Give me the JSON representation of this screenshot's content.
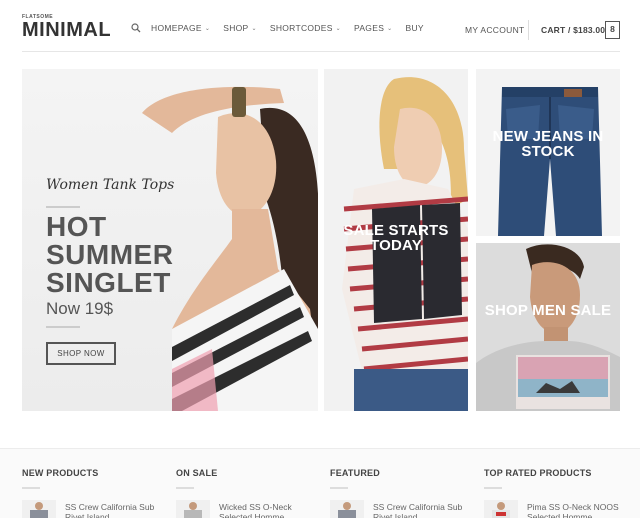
{
  "header": {
    "logo_small": "FLATSOME",
    "logo_main": "MINIMAL",
    "nav": [
      {
        "label": "HOMEPAGE",
        "has_dropdown": true
      },
      {
        "label": "SHOP",
        "has_dropdown": true
      },
      {
        "label": "SHORTCODES",
        "has_dropdown": true
      },
      {
        "label": "PAGES",
        "has_dropdown": true
      },
      {
        "label": "BUY",
        "has_dropdown": false
      }
    ],
    "account": "MY ACCOUNT",
    "cart": "CART / $183.00",
    "cart_count": "8"
  },
  "banners": {
    "main": {
      "script": "Women Tank Tops",
      "headline": "HOT SUMMER SINGLET",
      "price": "Now 19$",
      "button": "SHOP NOW"
    },
    "sale": {
      "text": "SALE STARTS TODAY"
    },
    "jeans": {
      "text": "NEW JEANS IN STOCK"
    },
    "men": {
      "text": "SHOP MEN SALE"
    }
  },
  "footer": {
    "columns": [
      {
        "title": "NEW PRODUCTS",
        "item": "SS Crew California Sub Rivet Island"
      },
      {
        "title": "ON SALE",
        "item": "Wicked SS O-Neck Selected Homme"
      },
      {
        "title": "FEATURED",
        "item": "SS Crew California Sub Rivet Island"
      },
      {
        "title": "TOP RATED PRODUCTS",
        "item": "Pima SS O-Neck NOOS Selected Homme"
      }
    ]
  },
  "colors": {
    "accent_dark": "#444444",
    "overlay_text": "#ffffff",
    "divider": "#e6e6e6"
  }
}
